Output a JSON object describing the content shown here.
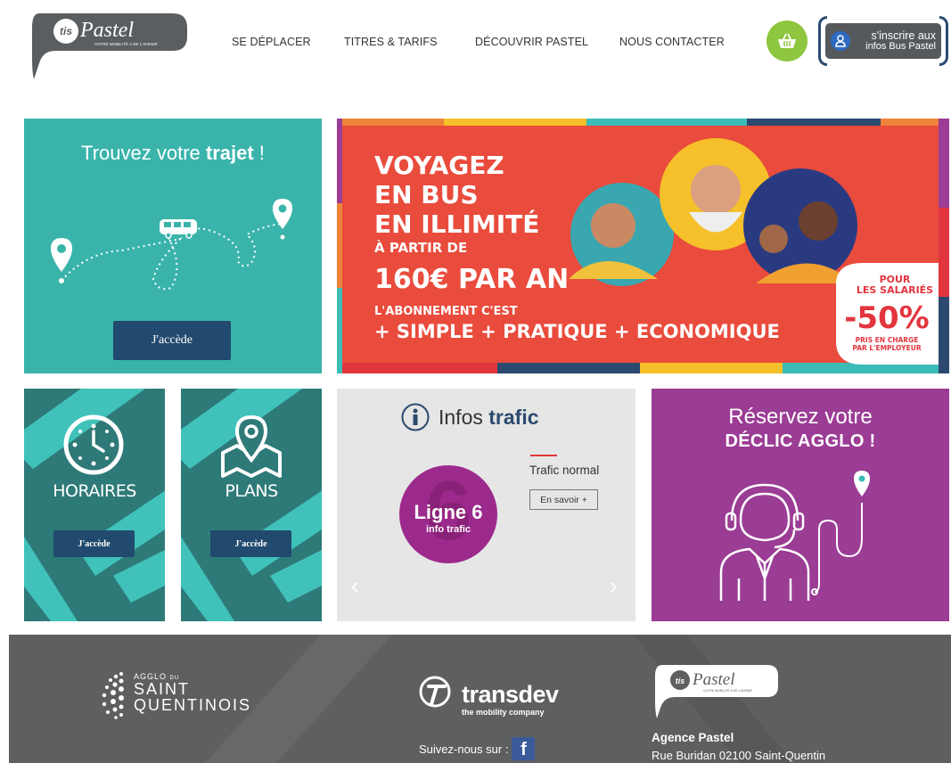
{
  "header": {
    "logo": {
      "brand": "Pastel",
      "tagline": "VOTRE MOBILITÉ À DE L'AVENIR"
    },
    "nav": [
      "SE DÉPLACER",
      "TITRES & TARIFS",
      "DÉCOUVRIR PASTEL",
      "NOUS CONTACTER"
    ],
    "cart_icon": "basket-icon",
    "subscribe": {
      "line1": "s'inscrire aux",
      "line2": "infos Bus Pastel"
    }
  },
  "trajet": {
    "title_prefix": "Trouvez votre ",
    "title_bold": "trajet",
    "title_suffix": " !",
    "button": "J'accède"
  },
  "banner": {
    "line1": "VOYAGEZ",
    "line2": "EN BUS",
    "line3": "EN ILLIMITÉ",
    "line4": "À PARTIR DE",
    "line5": "160€ PAR AN",
    "line6": "L'ABONNEMENT C'EST",
    "line7": "+ SIMPLE  + PRATIQUE  + ECONOMIQUE",
    "badge_top": "POUR",
    "badge_top2": "LES SALARIÉS",
    "badge_pct": "-50%",
    "badge_bottom": "PRIS EN CHARGE",
    "badge_bottom2": "PAR L'EMPLOYEUR"
  },
  "horaires": {
    "label": "HORAIRES",
    "button": "J'accède"
  },
  "plans": {
    "label": "PLANS",
    "button": "J'accède"
  },
  "trafic": {
    "title": "Infos ",
    "title_bold": "trafic",
    "line_number": "6",
    "line_label": "Ligne 6",
    "line_sub": "info trafic",
    "status": "Trafic normal",
    "more": "En savoir +"
  },
  "declic": {
    "line1": "Réservez votre",
    "line2": "DÉCLIC AGGLO !"
  },
  "footer": {
    "agglo_small": "AGGLO",
    "agglo_du": "DU",
    "agglo_l1": "SAINT",
    "agglo_l2": "QUENTINOIS",
    "transdev": "transdev",
    "transdev_sub": "the mobility company",
    "follow": "Suivez-nous sur :",
    "fb": "f",
    "pastel_brand": "Pastel",
    "pastel_tagline": "VOTRE MOBILITÉ À DE L'AVENIR",
    "agence": "Agence Pastel",
    "address": "Rue Buridan 02100 Saint-Quentin"
  },
  "colors": {
    "teal": "#3ab4ab",
    "dark_teal": "#2e7a78",
    "navy": "#214a6e",
    "banner_red": "#e94b3c",
    "purple": "#9b3c95",
    "cart_green": "#8ec63f",
    "footer_gray": "#5d5f60"
  }
}
